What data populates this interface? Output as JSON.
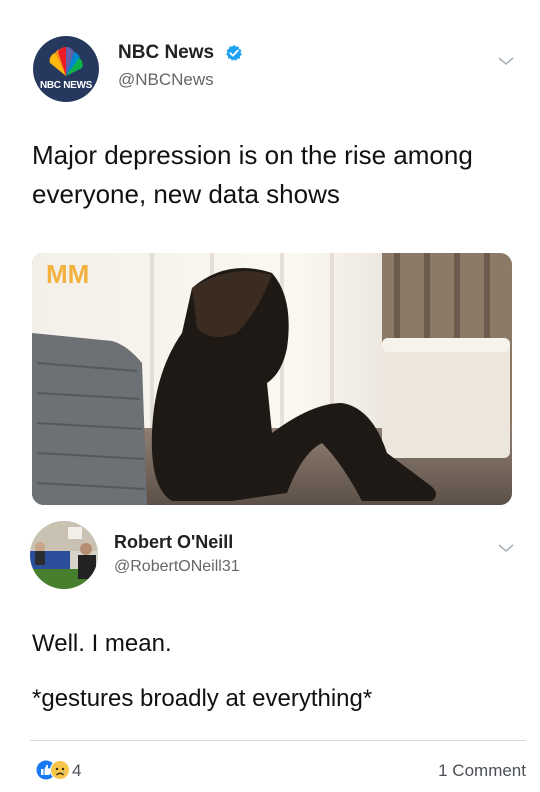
{
  "tweet": {
    "author_name": "NBC News",
    "author_handle": "@NBCNews",
    "avatar_text": "NBC NEWS",
    "text": "Major depression is on the rise among everyone, new data shows",
    "image_overlay_text": "MM"
  },
  "reply": {
    "author_name": "Robert O'Neill",
    "author_handle": "@RobertONeill31",
    "line1": "Well. I mean.",
    "line2": "*gestures broadly at everything*"
  },
  "reactions": {
    "count": "4",
    "comments": "1 Comment",
    "icons": [
      "like-icon",
      "sad-icon"
    ]
  },
  "colors": {
    "verified_blue": "#1da1f2",
    "nbc_navy": "#27385f",
    "facebook_blue": "#1877f2",
    "sad_yellow": "#f7c64a"
  }
}
